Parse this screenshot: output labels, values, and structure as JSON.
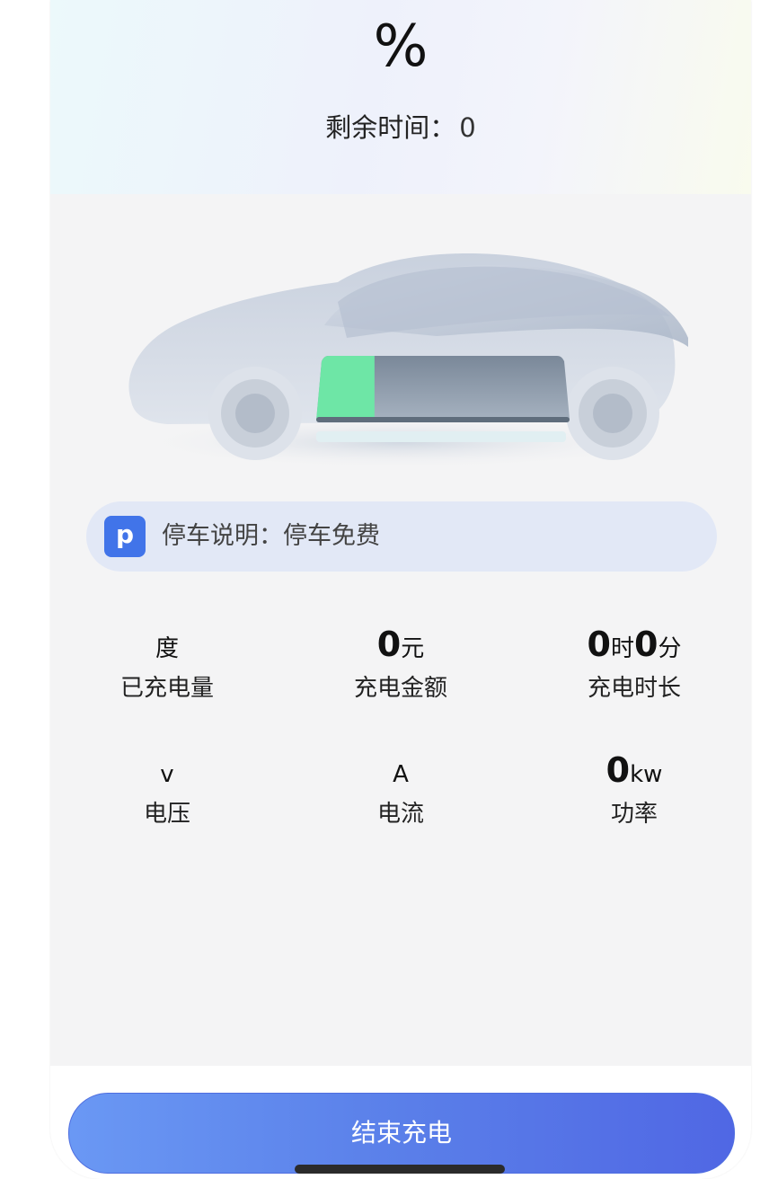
{
  "header": {
    "percent_sign": "%",
    "remaining_label": "剩余时间：",
    "remaining_value": "0"
  },
  "battery": {
    "fill_color": "#6ee6a6",
    "level_fraction": 0.23
  },
  "parking": {
    "badge": "p",
    "text": "停车说明：停车免费"
  },
  "stats": {
    "charged": {
      "value": "",
      "unit": "度",
      "label": "已充电量"
    },
    "amount": {
      "value": "0",
      "unit": "元",
      "label": "充电金额"
    },
    "duration": {
      "hours": "0",
      "hours_unit": "时",
      "minutes": "0",
      "minutes_unit": "分",
      "label": "充电时长"
    },
    "voltage": {
      "value": "",
      "unit": "v",
      "label": "电压"
    },
    "current": {
      "value": "",
      "unit": "A",
      "label": "电流"
    },
    "power": {
      "value": "0",
      "unit": "kw",
      "label": "功率"
    }
  },
  "footer": {
    "end_button": "结束充电"
  },
  "colors": {
    "accent": "#5a7fe9",
    "badge": "#4174e9",
    "parking_bg": "#e2e8f6"
  }
}
